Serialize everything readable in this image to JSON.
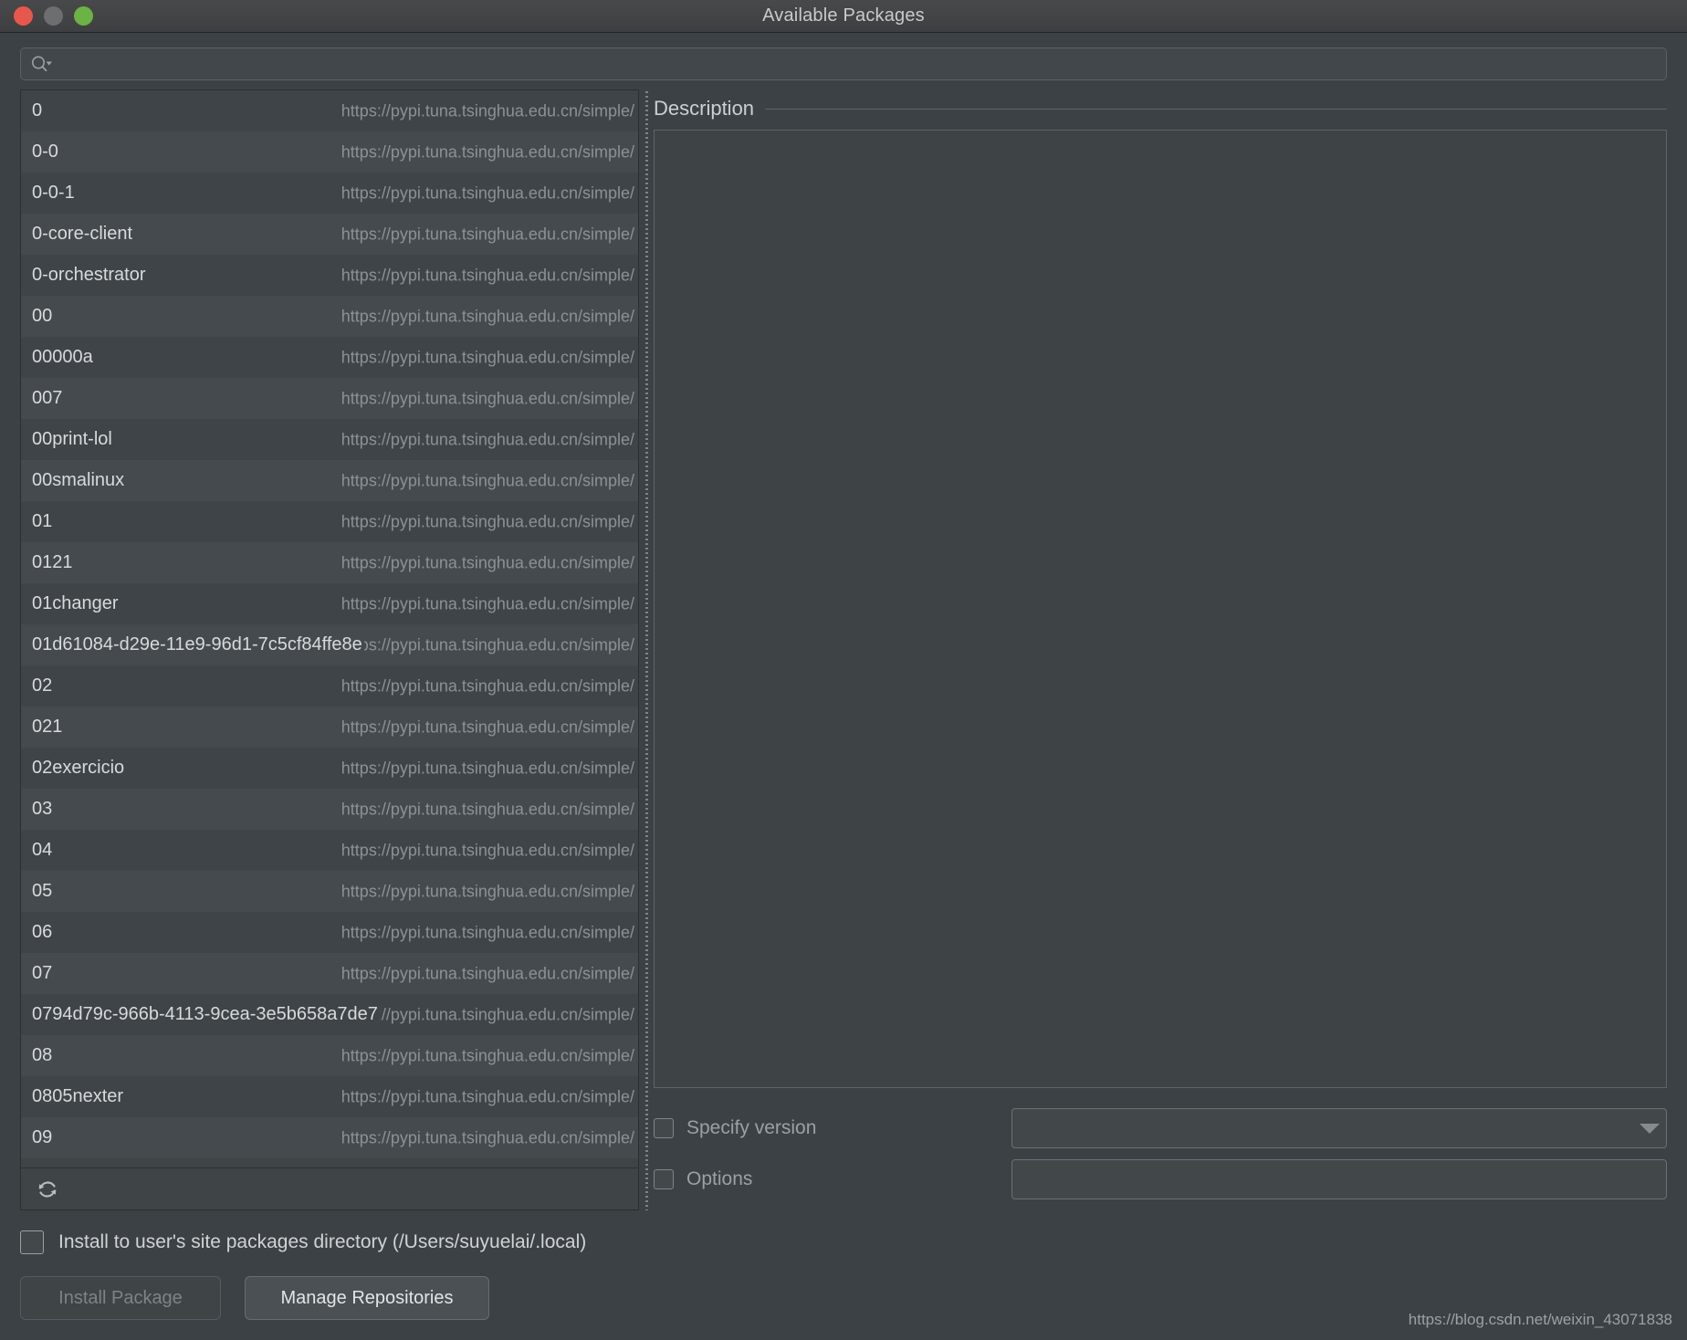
{
  "window": {
    "title": "Available Packages",
    "traffic_lights": {
      "close_color": "#e8574c",
      "minimize_color": "#6e6e6e",
      "zoom_color": "#6ab344"
    }
  },
  "search": {
    "value": "",
    "placeholder": "",
    "icon": "search-icon"
  },
  "packages": {
    "repository_url": "https://pypi.tuna.tsinghua.edu.cn/simple/",
    "rows": [
      {
        "name": "0",
        "url": "https://pypi.tuna.tsinghua.edu.cn/simple/"
      },
      {
        "name": "0-0",
        "url": "https://pypi.tuna.tsinghua.edu.cn/simple/"
      },
      {
        "name": "0-0-1",
        "url": "https://pypi.tuna.tsinghua.edu.cn/simple/"
      },
      {
        "name": "0-core-client",
        "url": "https://pypi.tuna.tsinghua.edu.cn/simple/"
      },
      {
        "name": "0-orchestrator",
        "url": "https://pypi.tuna.tsinghua.edu.cn/simple/"
      },
      {
        "name": "00",
        "url": "https://pypi.tuna.tsinghua.edu.cn/simple/"
      },
      {
        "name": "00000a",
        "url": "https://pypi.tuna.tsinghua.edu.cn/simple/"
      },
      {
        "name": "007",
        "url": "https://pypi.tuna.tsinghua.edu.cn/simple/"
      },
      {
        "name": "00print-lol",
        "url": "https://pypi.tuna.tsinghua.edu.cn/simple/"
      },
      {
        "name": "00smalinux",
        "url": "https://pypi.tuna.tsinghua.edu.cn/simple/"
      },
      {
        "name": "01",
        "url": "https://pypi.tuna.tsinghua.edu.cn/simple/"
      },
      {
        "name": "0121",
        "url": "https://pypi.tuna.tsinghua.edu.cn/simple/"
      },
      {
        "name": "01changer",
        "url": "https://pypi.tuna.tsinghua.edu.cn/simple/"
      },
      {
        "name": "01d61084-d29e-11e9-96d1-7c5cf84ffe8e",
        "url": "https://pypi.tuna.tsinghua.edu.cn/simple/"
      },
      {
        "name": "02",
        "url": "https://pypi.tuna.tsinghua.edu.cn/simple/"
      },
      {
        "name": "021",
        "url": "https://pypi.tuna.tsinghua.edu.cn/simple/"
      },
      {
        "name": "02exercicio",
        "url": "https://pypi.tuna.tsinghua.edu.cn/simple/"
      },
      {
        "name": "03",
        "url": "https://pypi.tuna.tsinghua.edu.cn/simple/"
      },
      {
        "name": "04",
        "url": "https://pypi.tuna.tsinghua.edu.cn/simple/"
      },
      {
        "name": "05",
        "url": "https://pypi.tuna.tsinghua.edu.cn/simple/"
      },
      {
        "name": "06",
        "url": "https://pypi.tuna.tsinghua.edu.cn/simple/"
      },
      {
        "name": "07",
        "url": "https://pypi.tuna.tsinghua.edu.cn/simple/"
      },
      {
        "name": "0794d79c-966b-4113-9cea-3e5b658a7de7",
        "url": "https://pypi.tuna.tsinghua.edu.cn/simple/"
      },
      {
        "name": "08",
        "url": "https://pypi.tuna.tsinghua.edu.cn/simple/"
      },
      {
        "name": "0805nexter",
        "url": "https://pypi.tuna.tsinghua.edu.cn/simple/"
      },
      {
        "name": "09",
        "url": "https://pypi.tuna.tsinghua.edu.cn/simple/"
      }
    ],
    "refresh_icon": "refresh-icon"
  },
  "description": {
    "title": "Description",
    "content": ""
  },
  "options": {
    "specify_version": {
      "label": "Specify version",
      "checked": false,
      "value": "",
      "dropdown_icon": "chevron-down-icon"
    },
    "extra_options": {
      "label": "Options",
      "checked": false,
      "value": ""
    }
  },
  "bottom": {
    "user_site_label": "Install to user's site packages directory (/Users/suyuelai/.local)",
    "user_site_checked": false,
    "install_button": "Install Package",
    "install_button_enabled": false,
    "manage_button": "Manage Repositories"
  },
  "watermark": "https://blog.csdn.net/weixin_43071838"
}
